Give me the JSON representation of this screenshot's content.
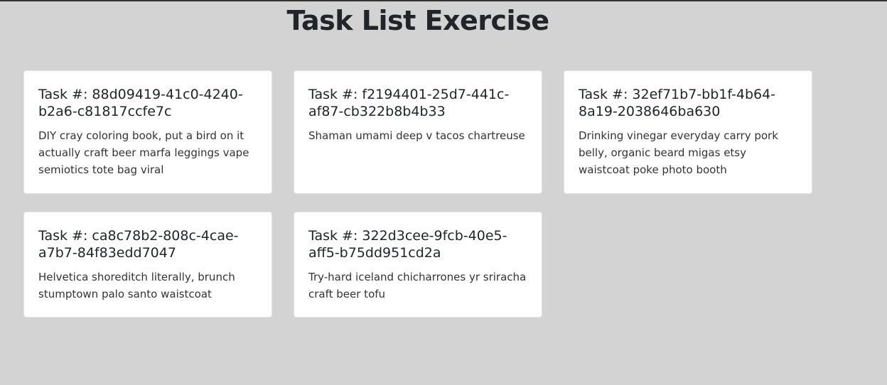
{
  "page": {
    "title": "Task List Exercise"
  },
  "tasks": [
    {
      "heading": "Task #: 88d09419-41c0-4240-b2a6-c81817ccfe7c",
      "description": "DIY cray coloring book, put a bird on it actually craft beer marfa leggings vape semiotics tote bag viral"
    },
    {
      "heading": "Task #: f2194401-25d7-441c-af87-cb322b8b4b33",
      "description": "Shaman umami deep v tacos chartreuse"
    },
    {
      "heading": "Task #: 32ef71b7-bb1f-4b64-8a19-2038646ba630",
      "description": "Drinking vinegar everyday carry pork belly, organic beard migas etsy waistcoat poke photo booth"
    },
    {
      "heading": "Task #: ca8c78b2-808c-4cae-a7b7-84f83edd7047",
      "description": "Helvetica shoreditch literally, brunch stumptown palo santo waistcoat"
    },
    {
      "heading": "Task #: 322d3cee-9fcb-40e5-aff5-b75dd951cd2a",
      "description": "Try-hard iceland chicharrones yr sriracha craft beer tofu"
    }
  ]
}
